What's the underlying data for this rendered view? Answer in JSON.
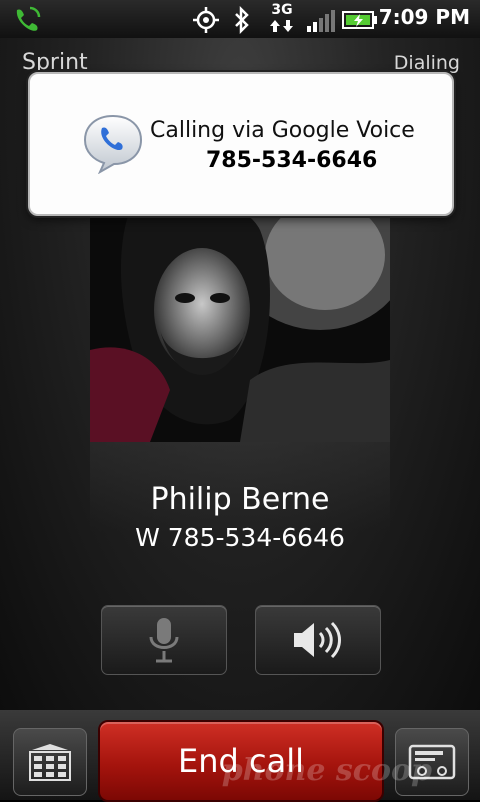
{
  "status_bar": {
    "time": "7:09 PM",
    "network": "3G",
    "icons": [
      "phone-active-icon",
      "gps-icon",
      "bluetooth-icon",
      "3g-data-icon",
      "signal-icon",
      "battery-icon"
    ]
  },
  "call": {
    "carrier": "Sprint",
    "state": "Dialing",
    "contact_name": "Philip Berne",
    "contact_number": "W 785-534-6646"
  },
  "toast": {
    "line1": "Calling via Google Voice",
    "line2": "785-534-6646",
    "icon": "google-voice-icon"
  },
  "controls": {
    "mute_icon": "microphone-icon",
    "speaker_icon": "speaker-icon",
    "keypad_icon": "keypad-icon",
    "contact_card_icon": "contact-card-icon",
    "end_call_label": "End call"
  },
  "watermark": "phone scoop",
  "colors": {
    "end_call": "#b3180f",
    "toast_bg": "#fdfdfd",
    "background": "#1a1a1a"
  }
}
